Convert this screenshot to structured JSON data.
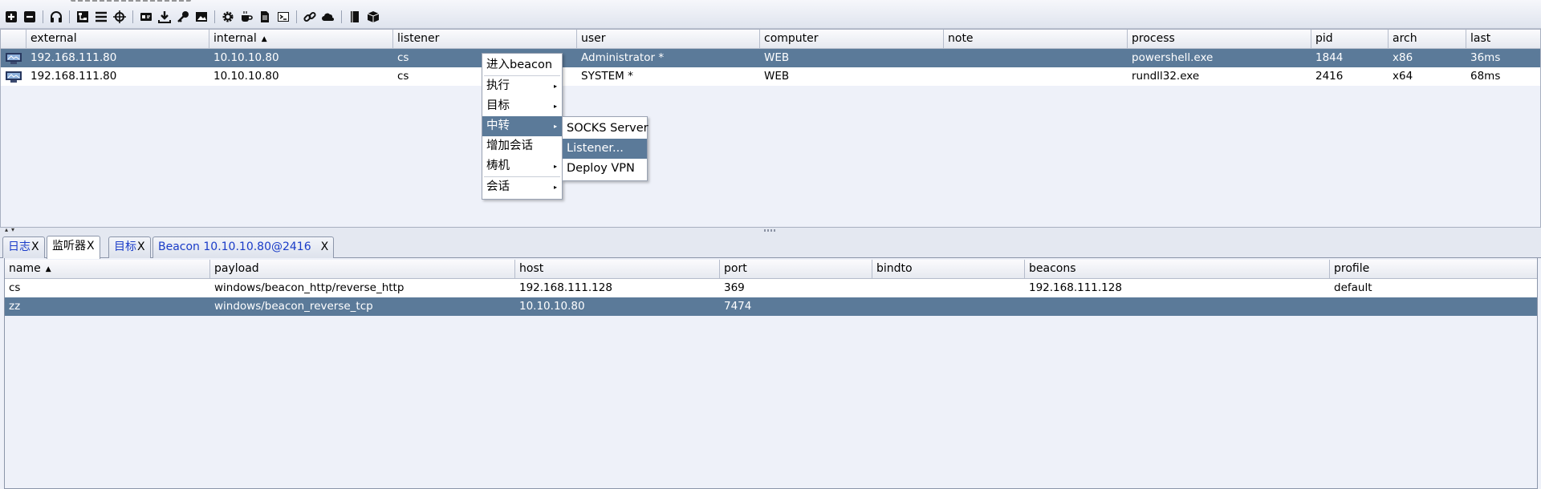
{
  "toolbar": {
    "icons": [
      "connect-icon",
      "disconnect-icon",
      "headset-icon",
      "graph-view-icon",
      "session-list-icon",
      "target-icon",
      "credentials-icon",
      "download-icon",
      "key-icon",
      "screenshot-icon",
      "settings-icon",
      "web-drive-by-icon",
      "document-icon",
      "console-icon",
      "link-icon",
      "cloud-icon",
      "book-icon",
      "package-icon"
    ]
  },
  "sessions": {
    "columns": [
      {
        "label": "external"
      },
      {
        "label": "internal",
        "sorted": "▲"
      },
      {
        "label": "listener"
      },
      {
        "label": "user"
      },
      {
        "label": "computer"
      },
      {
        "label": "note"
      },
      {
        "label": "process"
      },
      {
        "label": "pid"
      },
      {
        "label": "arch"
      },
      {
        "label": "last"
      }
    ],
    "rows": [
      {
        "external": "192.168.111.80",
        "internal": "10.10.10.80",
        "listener": "cs",
        "user": "Administrator *",
        "computer": "WEB",
        "note": "",
        "process": "powershell.exe",
        "pid": "1844",
        "arch": "x86",
        "last": "36ms",
        "selected": true
      },
      {
        "external": "192.168.111.80",
        "internal": "10.10.10.80",
        "listener": "cs",
        "user": "SYSTEM *",
        "computer": "WEB",
        "note": "",
        "process": "rundll32.exe",
        "pid": "2416",
        "arch": "x64",
        "last": "68ms",
        "selected": false
      }
    ]
  },
  "context_menu": {
    "items": [
      {
        "label": "进入beacon"
      },
      {
        "label": "执行",
        "submenu": "▸"
      },
      {
        "label": "目标",
        "submenu": "▸"
      },
      {
        "label": "中转",
        "submenu": "▸"
      },
      {
        "label": "增加会话"
      },
      {
        "label": "梼机",
        "submenu": "▸"
      },
      {
        "label": "会话",
        "submenu": "▸"
      }
    ],
    "submenu": {
      "items": [
        {
          "label": "SOCKS Server"
        },
        {
          "label": "Listener..."
        },
        {
          "label": "Deploy VPN"
        }
      ]
    }
  },
  "splitter": {
    "arrows": "▴▾"
  },
  "tabs": [
    {
      "label": "日志",
      "close": "X"
    },
    {
      "label": "监听器",
      "close": "X"
    },
    {
      "label": "目标",
      "close": "X"
    },
    {
      "label": "Beacon 10.10.10.80@2416",
      "close": "X"
    }
  ],
  "listeners": {
    "columns": [
      {
        "label": "name",
        "sorted": "▲"
      },
      {
        "label": "payload"
      },
      {
        "label": "host"
      },
      {
        "label": "port"
      },
      {
        "label": "bindto"
      },
      {
        "label": "beacons"
      },
      {
        "label": "profile"
      }
    ],
    "rows": [
      {
        "name": "cs",
        "payload": "windows/beacon_http/reverse_http",
        "host": "192.168.111.128",
        "port": "369",
        "bindto": "",
        "beacons": "192.168.111.128",
        "profile": "default",
        "selected": false
      },
      {
        "name": "zz",
        "payload": "windows/beacon_reverse_tcp",
        "host": "10.10.10.80",
        "port": "7474",
        "bindto": "",
        "beacons": "",
        "profile": "",
        "selected": true
      }
    ]
  },
  "colors": {
    "selection": "#5b7a99",
    "panel_bg": "#eef1f9",
    "tab_link": "#1a3cc8"
  }
}
